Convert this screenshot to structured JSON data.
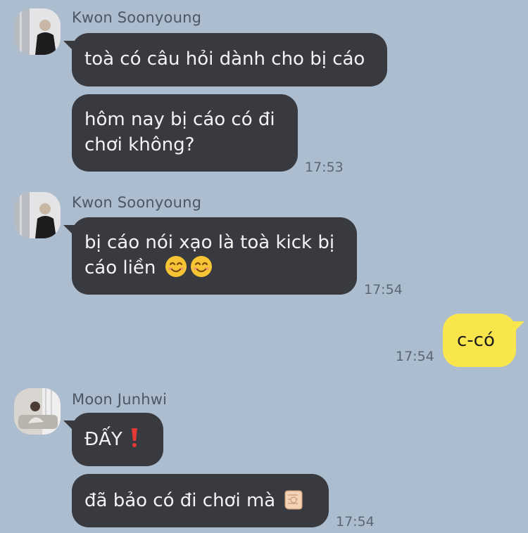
{
  "colors": {
    "background": "#abbdcf",
    "incoming_bubble": "#393a3f",
    "outgoing_bubble": "#f9e54c"
  },
  "messages": [
    {
      "sender": "Kwon Soonyoung",
      "lines": [
        "toà có câu hỏi dành cho bị cáo",
        "hôm nay bị cáo có đi chơi không?"
      ],
      "time": "17:53"
    },
    {
      "sender": "Kwon Soonyoung",
      "text": "bị cáo nói xạo là toà kick bị cáo liền",
      "emojis": [
        "smiling-face-icon",
        "smiling-face-icon"
      ],
      "time": "17:54"
    },
    {
      "sender": "me",
      "text": "c-có",
      "time": "17:54"
    },
    {
      "sender": "Moon Junhwi",
      "lines": [
        "ĐẤY",
        "đã bảo có đi chơi mà"
      ],
      "emojis": [
        "red-exclamation-icon",
        "pointing-hand-icon"
      ],
      "time": "17:54"
    }
  ]
}
